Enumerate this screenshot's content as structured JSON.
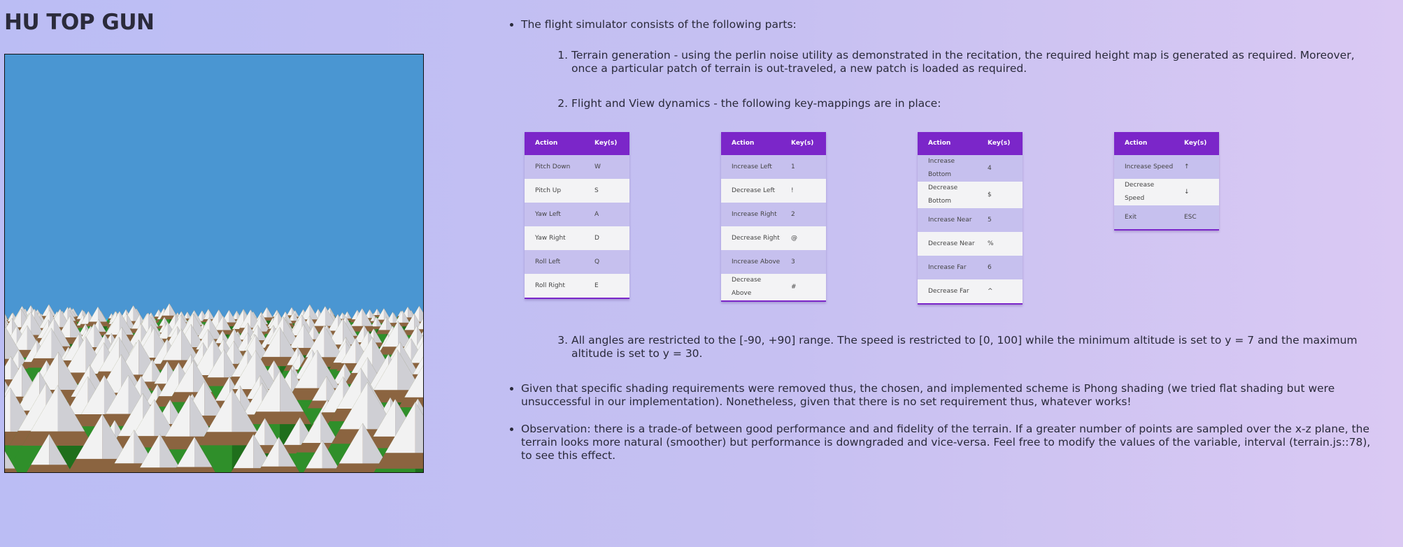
{
  "page_title": "HU TOP GUN",
  "content": {
    "intro": "The flight simulator consists of the following parts:",
    "parts": [
      "Terrain generation - using the perlin noise utility as demonstrated in the recitation, the required height map is generated as required. Moreover, once a particular patch of terrain is out-traveled, a new patch is loaded as required.",
      "Flight and View dynamics - the following key-mappings are in place:",
      "All angles are restricted to the [-90, +90] range. The speed is restricted to [0, 100] while the minimum altitude is set to y = 7 and the maximum altitude is set to y = 30."
    ],
    "shading": "Given that specific shading requirements were removed thus, the chosen, and implemented scheme is Phong shading (we tried flat shading but were unsuccessful in our implementation). Nonetheless, given that there is no set requirement thus, whatever works!",
    "observation": "Observation: there is a trade-of between good performance and and fidelity of the terrain. If a greater number of points are sampled over the x-z plane, the terrain looks more natural (smoother) but performance is downgraded and vice-versa. Feel free to modify the values of the variable, interval (terrain.js::78), to see this effect."
  },
  "tables": [
    {
      "headers": [
        "Action",
        "Key(s)"
      ],
      "rows": [
        [
          "Pitch Down",
          "W"
        ],
        [
          "Pitch Up",
          "S"
        ],
        [
          "Yaw Left",
          "A"
        ],
        [
          "Yaw Right",
          "D"
        ],
        [
          "Roll Left",
          "Q"
        ],
        [
          "Roll Right",
          "E"
        ]
      ]
    },
    {
      "headers": [
        "Action",
        "Key(s)"
      ],
      "rows": [
        [
          "Increase Left",
          "1"
        ],
        [
          "Decrease Left",
          "!"
        ],
        [
          "Increase Right",
          "2"
        ],
        [
          "Decrease Right",
          "@"
        ],
        [
          "Increase Above",
          "3"
        ],
        [
          "Decrease Above",
          "#"
        ]
      ]
    },
    {
      "headers": [
        "Action",
        "Key(s)"
      ],
      "rows": [
        [
          "Increase Bottom",
          "4"
        ],
        [
          "Decrease Bottom",
          "$"
        ],
        [
          "Increase Near",
          "5"
        ],
        [
          "Decrease Near",
          "%"
        ],
        [
          "Increase Far",
          "6"
        ],
        [
          "Decrease Far",
          "^"
        ]
      ]
    },
    {
      "headers": [
        "Action",
        "Key(s)"
      ],
      "rows": [
        [
          "Increase Speed",
          "↑"
        ],
        [
          "Decrease Speed",
          "↓"
        ],
        [
          "Exit",
          "ESC"
        ]
      ]
    }
  ],
  "colors": {
    "table_header": "#7b26c9",
    "sky": "#4a96d2",
    "water": "#16d0ef",
    "tree": "#2f8f2a",
    "trunk": "#8b6440",
    "snow": "#f2f2f2"
  }
}
